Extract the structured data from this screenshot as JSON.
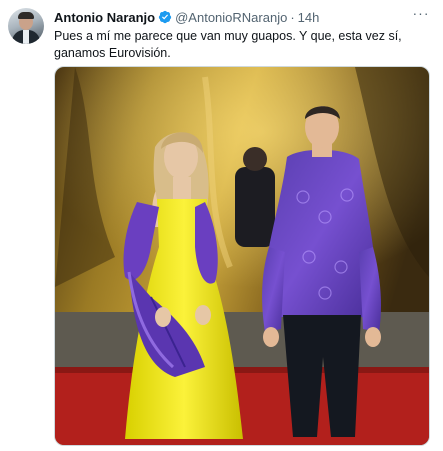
{
  "tweet": {
    "author_name": "Antonio Naranjo",
    "handle": "@AntonioRNaranjo",
    "separator": "·",
    "time": "14h",
    "text": "Pues a mí me parece que van muy guapos. Y que, esta vez sí, ganamos Eurovisión.",
    "verified": true,
    "more_glyph": "···"
  },
  "icons": {
    "verified": "verified-badge-icon",
    "more": "more-options-icon"
  },
  "colors": {
    "verified_blue": "#1d9bf0",
    "text_primary": "#0f1419",
    "text_secondary": "#536471",
    "border": "#cfd9de"
  }
}
